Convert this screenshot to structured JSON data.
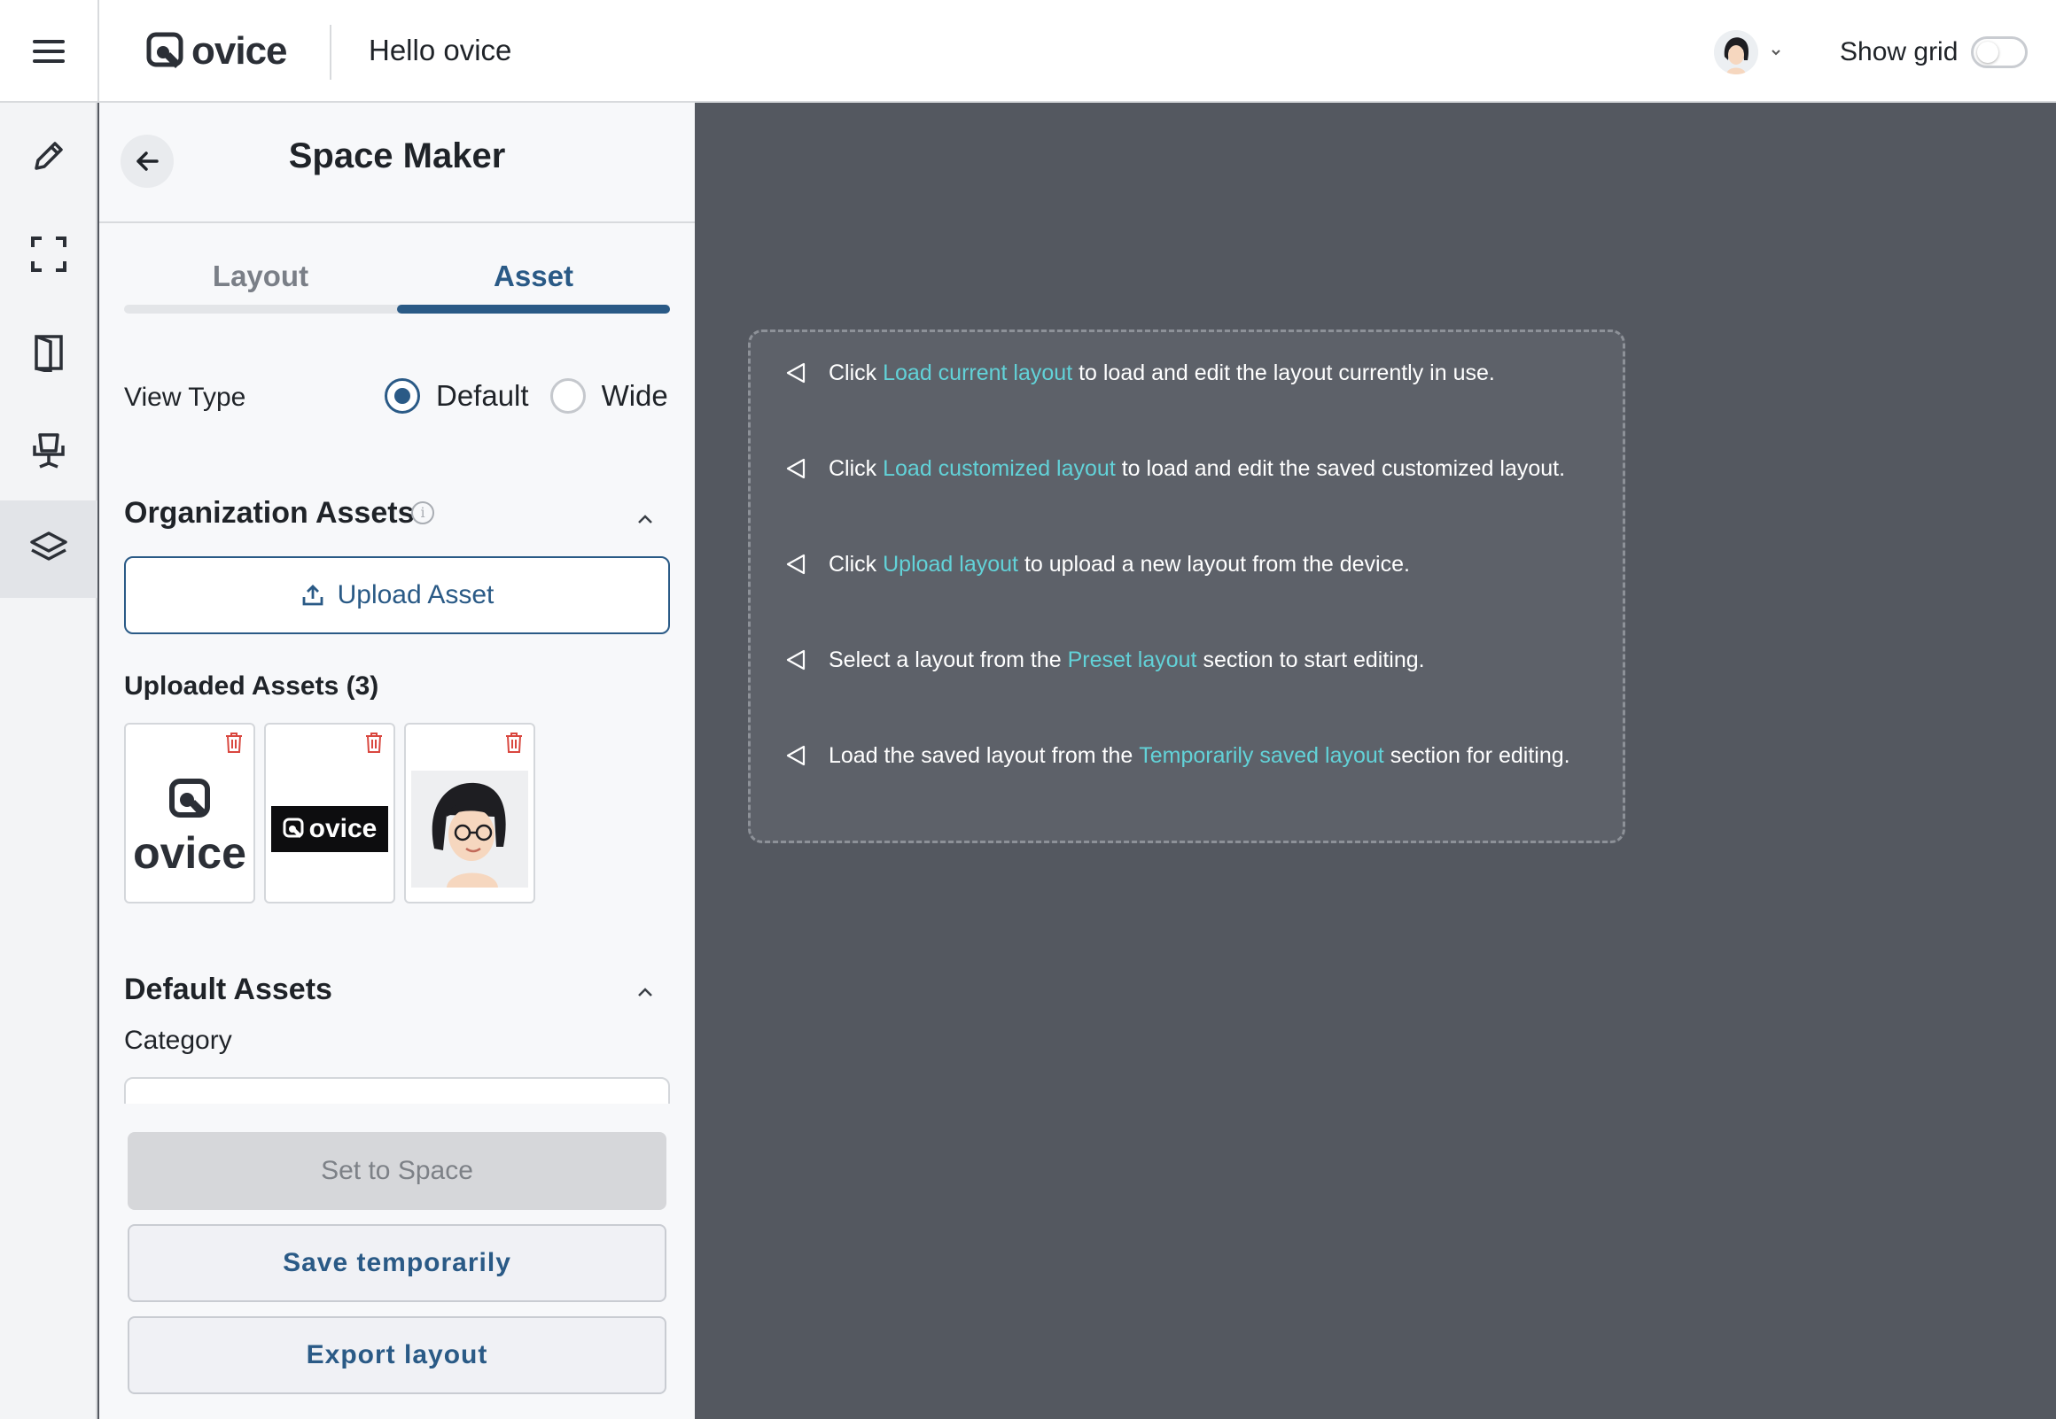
{
  "header": {
    "logo_text": "ovice",
    "title": "Hello ovice",
    "show_grid_label": "Show grid",
    "show_grid_on": false
  },
  "rail": {
    "items": [
      {
        "name": "edit",
        "icon": "pencil-icon"
      },
      {
        "name": "fullscreen",
        "icon": "fullscreen-icon"
      },
      {
        "name": "door",
        "icon": "door-icon"
      },
      {
        "name": "furniture",
        "icon": "chair-icon"
      },
      {
        "name": "assets",
        "icon": "layers-icon",
        "active": true
      }
    ]
  },
  "panel": {
    "title": "Space Maker",
    "tabs": [
      {
        "label": "Layout",
        "active": false
      },
      {
        "label": "Asset",
        "active": true
      }
    ],
    "view_type": {
      "label": "View Type",
      "options": [
        "Default",
        "Wide"
      ],
      "selected": "Default"
    },
    "org_assets": {
      "title": "Organization Assets",
      "upload_label": "Upload Asset",
      "uploaded_label": "Uploaded Assets (3)",
      "items": [
        {
          "alt": "ovice logo square"
        },
        {
          "alt": "ovice logo black banner",
          "text": "ovice"
        },
        {
          "alt": "character avatar"
        }
      ]
    },
    "default_assets": {
      "title": "Default Assets",
      "category_label": "Category"
    },
    "footer": {
      "set_to_space": "Set to Space",
      "save_temporarily": "Save temporarily",
      "export_layout": "Export layout"
    }
  },
  "hints": [
    {
      "before": "Click ",
      "link": "Load current layout",
      "after": " to load and edit the layout currently in use."
    },
    {
      "before": "Click ",
      "link": "Load customized layout",
      "after": " to load and edit the saved customized layout."
    },
    {
      "before": "Click ",
      "link": "Upload layout",
      "after": " to upload a new layout from the device."
    },
    {
      "before": "Select a layout from the ",
      "link": "Preset layout",
      "after": " section to start editing."
    },
    {
      "before": "Load the saved layout from the ",
      "link": "Temporarily saved layout",
      "after": " section for editing."
    }
  ],
  "colors": {
    "accent": "#2a5a86",
    "link": "#62d2d8",
    "canvas": "#545860",
    "danger": "#d9473f"
  }
}
